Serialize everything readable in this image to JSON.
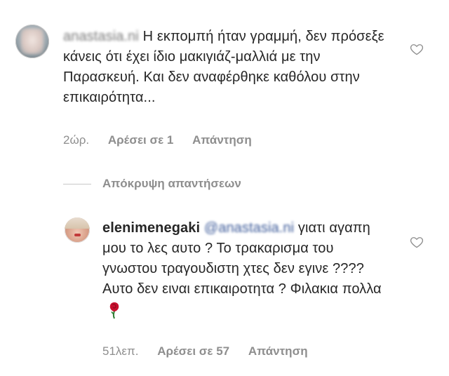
{
  "comment_1": {
    "username_redacted": "anastasia.ni",
    "text": "Η εκπομπή ήταν γραμμή, δεν πρόσεξε κάνεις ότι έχει ίδιο μακιγιάζ-μαλλιά με την Παρασκευή. Και δεν αναφέρθηκε καθόλου στην επικαιρότητα...",
    "time": "2ώρ.",
    "likes_label": "Αρέσει σε 1",
    "reply_label": "Απάντηση",
    "icon": "heart-outline-icon"
  },
  "replies_toggle": {
    "label": "Απόκρυψη απαντήσεων"
  },
  "comment_2": {
    "username": "elenimenegaki",
    "mention_redacted": "@anastasia.ni",
    "text": "γιατι αγαπη μου το λες αυτο ? Το τρακαρισμα του γνωστου τραγουδιστη χτες δεν εγινε ???? Αυτο δεν ειναι επικαιροτητα ? Φιλακια πολλα",
    "emoji": "rose-icon",
    "time": "51λεπ.",
    "likes_label": "Αρέσει σε 57",
    "reply_label": "Απάντηση",
    "icon": "heart-outline-icon"
  },
  "colors": {
    "text": "#262626",
    "meta": "#8e8e8e",
    "mention": "#3b5998",
    "rose": "#c8102e"
  }
}
